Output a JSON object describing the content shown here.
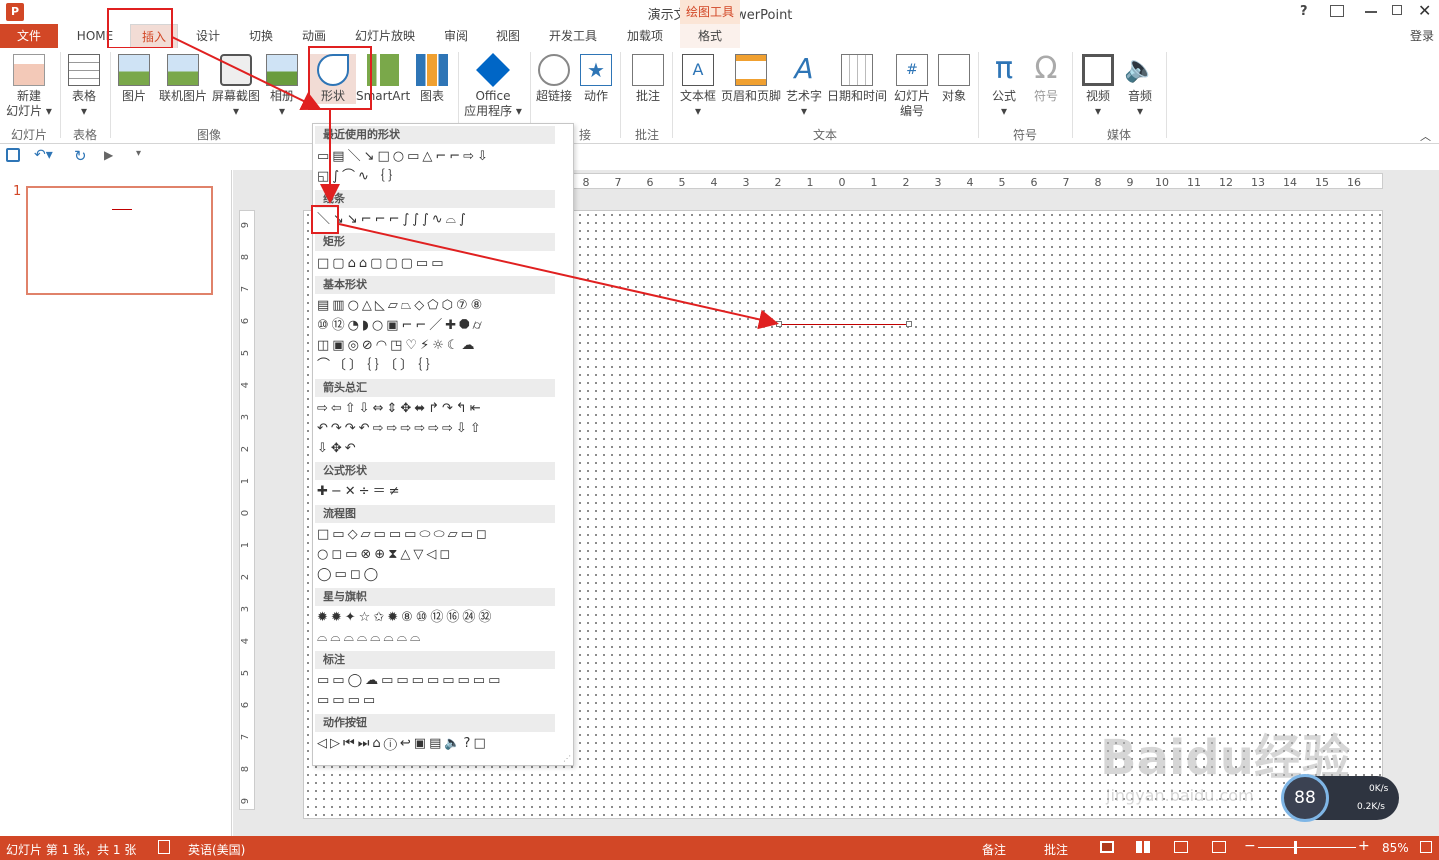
{
  "window": {
    "title": "演示文稿1 - PowerPoint",
    "contextual_group": "绘图工具",
    "help": "?",
    "login": "登录"
  },
  "tabs": [
    {
      "label": "文件"
    },
    {
      "label": "HOME"
    },
    {
      "label": "插入"
    },
    {
      "label": "设计"
    },
    {
      "label": "切换"
    },
    {
      "label": "动画"
    },
    {
      "label": "幻灯片放映"
    },
    {
      "label": "审阅"
    },
    {
      "label": "视图"
    },
    {
      "label": "开发工具"
    },
    {
      "label": "加载项"
    },
    {
      "label": "格式"
    }
  ],
  "ribbon": {
    "buttons": [
      {
        "label": "新建\n幻灯片 ▾"
      },
      {
        "label": "表格\n▾"
      },
      {
        "label": "图片"
      },
      {
        "label": "联机图片"
      },
      {
        "label": "屏幕截图\n▾"
      },
      {
        "label": "相册\n▾"
      },
      {
        "label": "形状"
      },
      {
        "label": "SmartArt"
      },
      {
        "label": "图表"
      },
      {
        "label": "Office\n应用程序 ▾"
      },
      {
        "label": "超链接"
      },
      {
        "label": "动作"
      },
      {
        "label": "批注"
      },
      {
        "label": "文本框\n▾"
      },
      {
        "label": "页眉和页脚"
      },
      {
        "label": "艺术字\n▾"
      },
      {
        "label": "日期和时间"
      },
      {
        "label": "幻灯片\n编号"
      },
      {
        "label": "对象"
      },
      {
        "label": "公式\n▾"
      },
      {
        "label": "符号"
      },
      {
        "label": "视频\n▾"
      },
      {
        "label": "音频\n▾"
      }
    ],
    "groups": [
      {
        "label": "幻灯片"
      },
      {
        "label": "表格"
      },
      {
        "label": "图像"
      },
      {
        "label": "接"
      },
      {
        "label": "批注"
      },
      {
        "label": "文本"
      },
      {
        "label": "符号"
      },
      {
        "label": "媒体"
      }
    ]
  },
  "gallery": {
    "categories": [
      {
        "label": "最近使用的形状"
      },
      {
        "label": "线条"
      },
      {
        "label": "矩形"
      },
      {
        "label": "基本形状"
      },
      {
        "label": "箭头总汇"
      },
      {
        "label": "公式形状"
      },
      {
        "label": "流程图"
      },
      {
        "label": "星与旗帜"
      },
      {
        "label": "标注"
      },
      {
        "label": "动作按钮"
      }
    ],
    "rows": [
      "▭▤＼↘□○▭△⌐⌐⇨⇩",
      "◱∫⌒∿｛｝",
      "＼↘↘⌐⌐⌐∫∫∫∿⌓∫",
      "□▢⌂⌂▢▢▢▭▭",
      "▤▥○△◺▱⏢◇⬠⬡⑦⑧",
      "⑩⑫◔◗○▣⌐⌐／✚⯃⌭",
      "◫▣◎⊘◠◳♡⚡☼☾☁",
      "⌒〔〕｛｝〔〕｛｝",
      "⇨⇦⇧⇩⇔⇕✥⬌↱↷↰⇤",
      "↶↷↷↶⇨⇨⇨⇨⇨⇨⇩⇧",
      "⇩✥↶",
      "✚−✕÷＝≠",
      "□▭◇▱▭▭▭⬭⬭▱▭◻",
      "○◻▭⊗⊕⧗△▽◁◻",
      "◯▭◻◯",
      "✹✹✦☆✩✹⑧⑩⑫⑯㉔㉜",
      "⌓⌓⌓⌓⌓⌓⌓⌓",
      "▭▭◯☁▭▭▭▭▭▭▭▭",
      "▭▭▭▭",
      "◁▷⏮⏭⌂ⓘ↩▣▤🔈?□"
    ]
  },
  "qat": {
    "save": "💾",
    "undo": "↶▾",
    "redo": "↻",
    "slideshow": "▶",
    "more": "▾"
  },
  "thumbnails": [
    {
      "number": "1"
    }
  ],
  "ruler": {
    "h": [
      "8",
      "7",
      "6",
      "5",
      "4",
      "3",
      "2",
      "1",
      "0",
      "1",
      "2",
      "3",
      "4",
      "5",
      "6",
      "7",
      "8",
      "9",
      "10",
      "11",
      "12",
      "13",
      "14",
      "15",
      "16"
    ],
    "v": [
      "9",
      "8",
      "7",
      "6",
      "5",
      "4",
      "3",
      "2",
      "1",
      "0",
      "1",
      "2",
      "3",
      "4",
      "5",
      "6",
      "7",
      "8",
      "9"
    ]
  },
  "status": {
    "slide": "幻灯片 第 1 张，共 1 张",
    "lang": "英语(美国)",
    "notes": "备注",
    "comments": "批注",
    "zoom": "85%"
  },
  "netmeter": {
    "percent": "88",
    "up": "0K/s",
    "down": "0.2K/s"
  },
  "watermark": {
    "text": "Baidu经验",
    "url": "jingyan.baidu.com"
  },
  "colors": {
    "accent": "#d24726",
    "annotation": "#e02020",
    "selected_tab": "#f2dcd5"
  }
}
